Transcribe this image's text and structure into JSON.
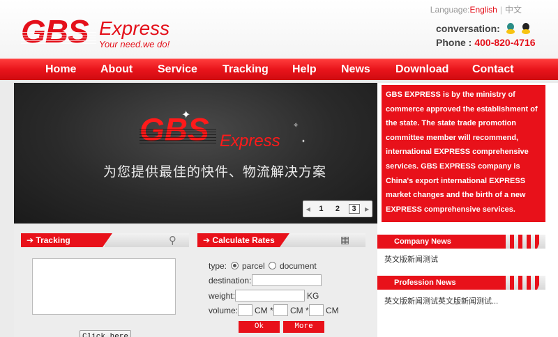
{
  "header": {
    "logo_main": "GBS",
    "logo_express": "Express",
    "logo_slogan": "Your need.we do!",
    "language_label": "Language:",
    "language_english": "English",
    "language_separator": "|",
    "language_chinese": "中文",
    "conversation_label": "conversation:",
    "phone_label": "Phone :",
    "phone_number": "400-820-4716"
  },
  "nav": {
    "items": [
      "Home",
      "About",
      "Service",
      "Tracking",
      "Help",
      "News",
      "Download",
      "Contact"
    ]
  },
  "banner": {
    "logo_main": "GBS",
    "logo_express": "Express",
    "subtitle": "为您提供最佳的快件、物流解决方案",
    "pager": {
      "pages": [
        "1",
        "2",
        "3"
      ],
      "current": "3"
    }
  },
  "intro": {
    "text": "GBS EXPRESS is by the ministry of commerce approved the establishment of the state. The state trade promotion committee member will recommend, international EXPRESS comprehensive services. GBS EXPRESS company is China's export international EXPRESS market changes and the birth of a new EXPRESS comprehensive services."
  },
  "tracking": {
    "title": "Tracking",
    "button_label": "Click here"
  },
  "calculate": {
    "title": "Calculate Rates",
    "type_label": "type:",
    "option_parcel": "parcel",
    "option_document": "document",
    "destination_label": "destination:",
    "weight_label": "weight:",
    "weight_unit": "KG",
    "volume_label": "volume:",
    "cm_times_1": "CM *",
    "cm_times_2": "CM *",
    "cm_end": "CM",
    "ok_label": "Ok",
    "more_label": "More"
  },
  "company_news": {
    "title": "Company News",
    "items": [
      "英文版新闻测试"
    ]
  },
  "profession_news": {
    "title": "Profession News",
    "items": [
      "英文版新闻测试英文版新闻测试..."
    ]
  },
  "colors": {
    "brand_red": "#e4101a",
    "nav_red": "#e8141b"
  }
}
